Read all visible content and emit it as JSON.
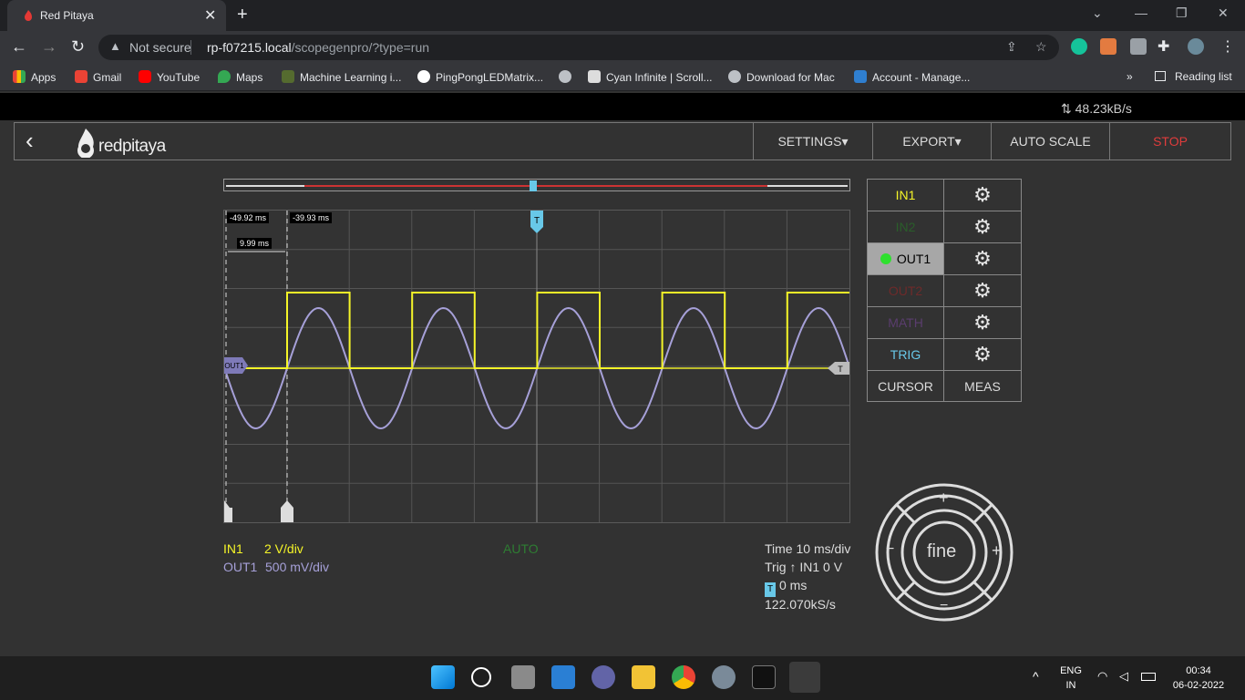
{
  "browser": {
    "tab_title": "Red Pitaya",
    "not_secure": "Not secure",
    "url_host": "rp-f07215.local",
    "url_path": "/scopegenpro/?type=run",
    "bookmarks": [
      "Apps",
      "Gmail",
      "YouTube",
      "Maps",
      "Machine Learning i...",
      "PingPongLEDMatrix...",
      "Cyan Infinite | Scroll...",
      "Download for Mac",
      "Account - Manage..."
    ],
    "reading_list": "Reading list",
    "chevron": "»"
  },
  "app": {
    "speed": "48.23kB/s",
    "logo_text": "redpitaya",
    "menu": {
      "settings": "SETTINGS▾",
      "export": "EXPORT▾",
      "autoscale": "AUTO SCALE",
      "stop": "STOP"
    }
  },
  "scope": {
    "cursor_x1": "-49.92 ms",
    "cursor_x2": "-39.93 ms",
    "cursor_delta": "9.99 ms",
    "trigger_marker": "T",
    "out1_marker": "OUT1",
    "in1_label": "IN1",
    "in1_scale": "2 V/div",
    "out1_label": "OUT1",
    "out1_scale": "500 mV/div",
    "trigger_mode": "AUTO",
    "time_scale": "Time 10 ms/div",
    "trig_info": "Trig ↑ IN1 0 V",
    "trig_offset": "0 ms",
    "sample_rate": "122.070kS/s",
    "colors": {
      "in1": "#f5f528",
      "out1": "#a6a0d8",
      "trig": "#68c8e8"
    }
  },
  "channels": {
    "in1": "IN1",
    "in2": "IN2",
    "out1": "OUT1",
    "out2": "OUT2",
    "math": "MATH",
    "trig": "TRIG",
    "cursor": "CURSOR",
    "meas": "MEAS"
  },
  "control": {
    "fine": "fine",
    "plus": "+",
    "minus": "−"
  },
  "taskbar": {
    "lang1": "ENG",
    "lang2": "IN",
    "time": "00:34",
    "date": "06-02-2022"
  }
}
